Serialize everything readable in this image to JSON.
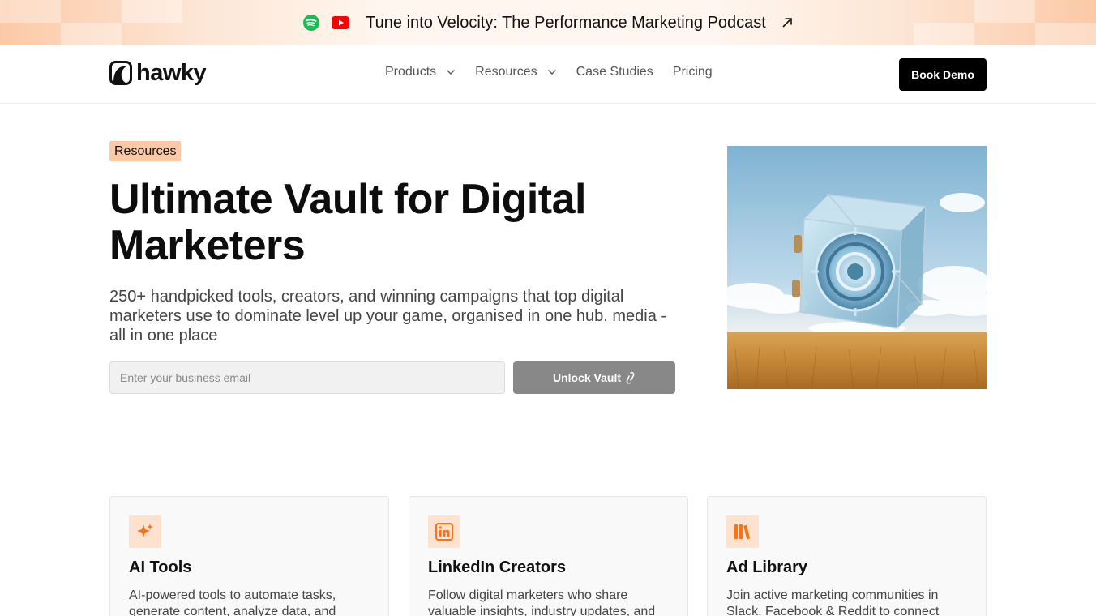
{
  "announcement": {
    "text": "Tune into Velocity: The Performance Marketing Podcast",
    "icons": [
      "spotify-icon",
      "youtube-icon",
      "arrow-up-right-icon"
    ],
    "spotify_color": "#1DB954",
    "youtube_color": "#FF0000"
  },
  "nav": {
    "logo_text": "hawky",
    "items": [
      {
        "label": "Products",
        "has_dropdown": true
      },
      {
        "label": "Resources",
        "has_dropdown": true
      },
      {
        "label": "Case Studies",
        "has_dropdown": false
      },
      {
        "label": "Pricing",
        "has_dropdown": false
      }
    ],
    "cta_label": "Book Demo"
  },
  "hero": {
    "tag": "Resources",
    "title": "Ultimate Vault for Digital Marketers",
    "subtitle": "250+ handpicked tools, creators, and winning campaigns that top digital marketers use to dominate level up your game, organised in one hub. media - all in one place",
    "email_placeholder": "Enter your business email",
    "email_value": "",
    "unlock_label": "Unlock Vault"
  },
  "cards": [
    {
      "title": "AI Tools",
      "description": "AI-powered tools to automate tasks, generate content, analyze data, and",
      "icon": "sparkle-icon"
    },
    {
      "title": "LinkedIn Creators",
      "description": "Follow digital marketers who share valuable insights, industry updates, and",
      "icon": "linkedin-icon"
    },
    {
      "title": "Ad Library",
      "description": "Join active marketing communities in Slack, Facebook & Reddit to connect",
      "icon": "library-icon"
    }
  ],
  "colors": {
    "accent": "#F97316",
    "tag_bg": "#FBC9A6",
    "card_icon_bg": "#FDE3CF",
    "cta_bg": "#000000",
    "unlock_bg": "#888888"
  }
}
